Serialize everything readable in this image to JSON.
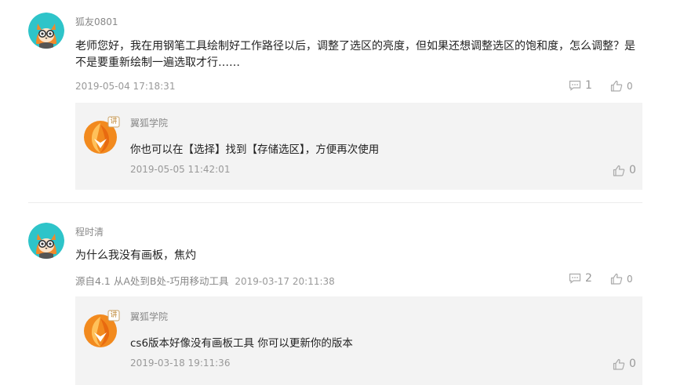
{
  "comments": [
    {
      "username": "狐友0801",
      "text_line1": "老师您好，我在用钢笔工具绘制好工作路径以后，调整了选区的亮度，但如果还想调整选区的饱和度，怎么调整？是",
      "text_line2": "不是要重新绘制一遍选取才行……",
      "source": "",
      "date": "2019-05-04 17:18:31",
      "reply_count": "1",
      "like_count": "0",
      "reply": {
        "name": "翼狐学院",
        "badge": "讲",
        "text": "你也可以在【选择】找到【存储选区】，方便再次使用",
        "date": "2019-05-05 11:42:01",
        "like_count": "0"
      }
    },
    {
      "username": "程时清",
      "text_line1": "为什么我没有画板，焦灼",
      "text_line2": "",
      "source": "源自4.1 从A处到B处-巧用移动工具",
      "date": "2019-03-17 20:11:38",
      "reply_count": "2",
      "like_count": "0",
      "reply": {
        "name": "翼狐学院",
        "badge": "讲",
        "text": "cs6版本好像没有画板工具 你可以更新你的版本",
        "date": "2019-03-18 19:11:36",
        "like_count": "0"
      }
    }
  ],
  "colors": {
    "avatar_bg": "#2ec4c9",
    "fox_orange": "#f0892b",
    "reply_bg": "#f3f3f3"
  }
}
